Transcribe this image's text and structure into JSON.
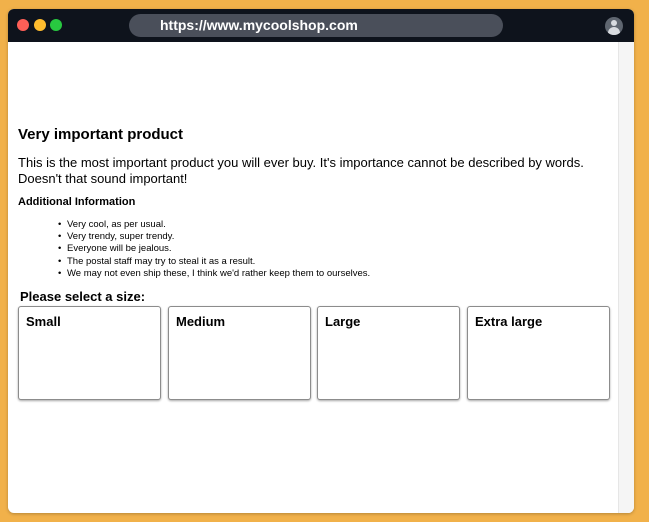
{
  "browser": {
    "url": "https://www.mycoolshop.com",
    "icons": [
      "close-icon",
      "minimize-icon",
      "zoom-icon",
      "profile-avatar-icon"
    ]
  },
  "product": {
    "title": "Very important product",
    "description": "This is the most important product you will ever buy. It's importance cannot be described by words. Doesn't that sound important!",
    "additional_heading": "Additional Information",
    "features": [
      "Very cool, as per usual.",
      "Very trendy, super trendy.",
      "Everyone will be jealous.",
      "The postal staff may try to steal it as a result.",
      "We may not even ship these, I think we'd rather keep them to ourselves."
    ]
  },
  "size_selector": {
    "prompt": "Please select a size:",
    "options": [
      "Small",
      "Medium",
      "Large",
      "Extra large"
    ]
  },
  "colors": {
    "background": "#f1b14a",
    "titlebar": "#0e131c",
    "urlbar": "#4a4f5a"
  }
}
